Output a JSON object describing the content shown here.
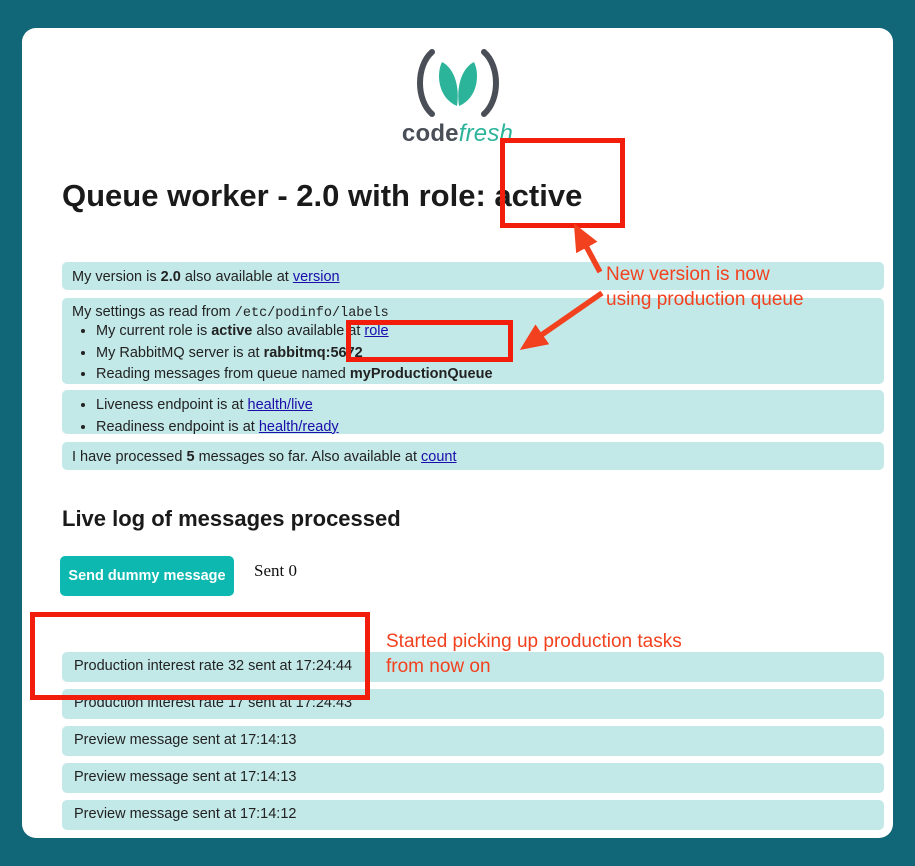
{
  "brand": {
    "logo_icon": "codefresh-leaf-logo",
    "word_part1": "code",
    "word_part2": "fresh",
    "leaf_color": "#2bb49a",
    "bracket_color": "#4a4f57"
  },
  "theme": {
    "page_background": "#116677",
    "card_background": "#ffffff",
    "panel_background": "#c3e8e8",
    "button_background": "#0cb8b0",
    "link_color": "#1a0dab",
    "annotation_color": "#f2411e"
  },
  "header": {
    "title_prefix": "Queue worker - 2.0 with role:",
    "title_role": "active"
  },
  "panels": {
    "version": {
      "text_before": "My version is ",
      "value": "2.0",
      "text_middle": " also available at ",
      "link": "version"
    },
    "settings": {
      "heading_prefix": "My settings as read from ",
      "heading_path": "/etc/podinfo/labels",
      "items": [
        {
          "prefix": "My current role is ",
          "value": "active",
          "middle": " also available at ",
          "link": "role"
        },
        {
          "prefix": "My RabbitMQ server is at ",
          "value": "rabbitmq:5672",
          "middle": "",
          "link": ""
        },
        {
          "prefix": "Reading messages from queue named ",
          "value": "myProductionQueue",
          "middle": "",
          "link": ""
        }
      ]
    },
    "health": {
      "liveness_prefix": "Liveness endpoint is at ",
      "liveness_link": "health/live",
      "readiness_prefix": "Readiness endpoint is at ",
      "readiness_link": "health/ready"
    },
    "count": {
      "text_before": "I have processed ",
      "value": "5",
      "text_middle": " messages so far. Also available at ",
      "link": "count"
    }
  },
  "live_log": {
    "heading": "Live log of messages processed",
    "send_button_label": "Send dummy message",
    "sent_label": "Sent 0",
    "messages": [
      "Production interest rate 32 sent at 17:24:44",
      "Production interest rate 17 sent at 17:24:43",
      "Preview message sent at 17:14:13",
      "Preview message sent at 17:14:13",
      "Preview message sent at 17:14:12"
    ]
  },
  "annotations": {
    "queue_note_line1": "New version is now",
    "queue_note_line2": "using production queue",
    "tasks_note_line1": "Started picking up production tasks",
    "tasks_note_line2": "from now on"
  }
}
